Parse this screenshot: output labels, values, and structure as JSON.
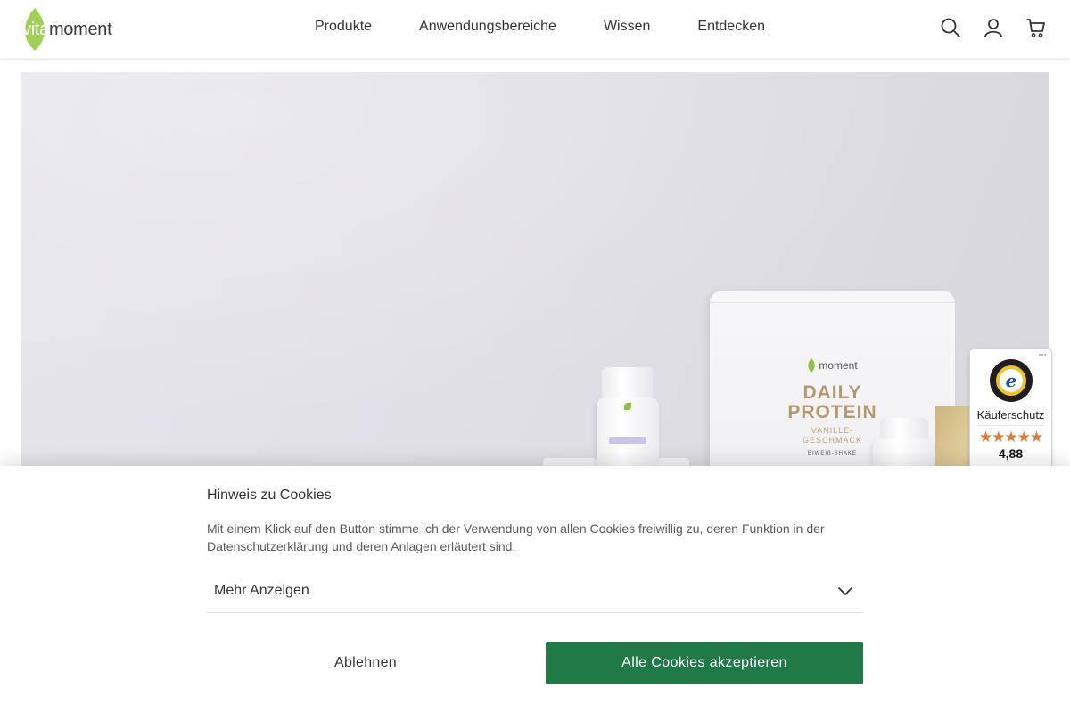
{
  "header": {
    "logo": {
      "vita": "vita",
      "moment": "moment"
    },
    "nav": [
      "Produkte",
      "Anwendungsbereiche",
      "Wissen",
      "Entdecken"
    ],
    "icons": [
      "search-icon",
      "user-icon",
      "cart-icon"
    ]
  },
  "hero": {
    "pouch": {
      "brand": "moment",
      "title_line1": "DAILY",
      "title_line2": "PROTEIN",
      "sub_line1": "VANILLE-",
      "sub_line2": "GESCHMACK",
      "bottom": "EIWEIß-SHAKE"
    }
  },
  "trusted_shops": {
    "label": "Käuferschutz",
    "stars": "★★★★★",
    "score": "4,88",
    "menu": "···"
  },
  "cookie_banner": {
    "title": "Hinweis zu Cookies",
    "text": "Mit einem Klick auf den Button stimme ich der Verwendung von allen Cookies freiwillig zu, deren Funktion in der Datenschutzerklärung und deren Anlagen erläutert sind.",
    "more_label": "Mehr Anzeigen",
    "decline_label": "Ablehnen",
    "accept_label": "Alle Cookies akzeptieren"
  },
  "colors": {
    "brand_green": "#8fc23f",
    "accept_button": "#1f7a48",
    "star_orange": "#e37c2f"
  }
}
